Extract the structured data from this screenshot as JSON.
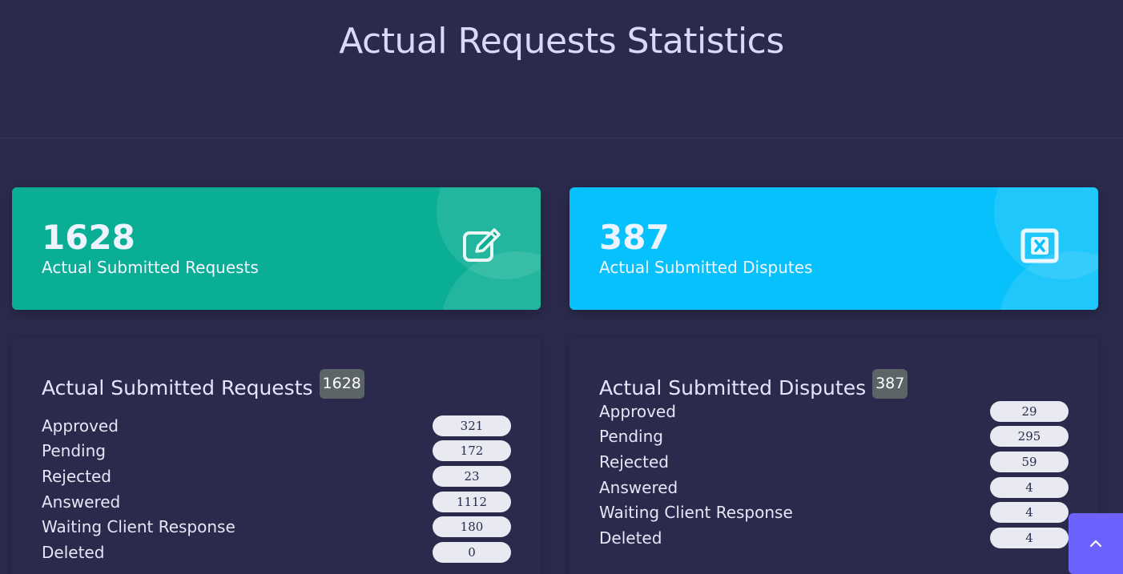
{
  "header": {
    "title": "Actual Requests Statistics"
  },
  "stat_cards": {
    "requests": {
      "value": "1628",
      "label": "Actual Submitted Requests",
      "icon": "edit-icon",
      "color": "#0aae94"
    },
    "disputes": {
      "value": "387",
      "label": "Actual Submitted Disputes",
      "icon": "close-box-icon",
      "color": "#06c1fb"
    }
  },
  "lists": {
    "requests": {
      "title": "Actual Submitted Requests",
      "total": "1628",
      "rows": [
        {
          "label": "Approved",
          "value": "321"
        },
        {
          "label": "Pending",
          "value": "172"
        },
        {
          "label": "Rejected",
          "value": "23"
        },
        {
          "label": "Answered",
          "value": "1112"
        },
        {
          "label": "Waiting Client Response",
          "value": "180"
        },
        {
          "label": "Deleted",
          "value": "0"
        }
      ]
    },
    "disputes": {
      "title": "Actual Submitted Disputes",
      "total": "387",
      "rows": [
        {
          "label": "Approved",
          "value": "29"
        },
        {
          "label": "Pending",
          "value": "295"
        },
        {
          "label": "Rejected",
          "value": "59"
        },
        {
          "label": "Answered",
          "value": "4"
        },
        {
          "label": "Waiting Client Response",
          "value": "4"
        },
        {
          "label": "Deleted",
          "value": "4"
        }
      ]
    }
  },
  "scroll_top": {
    "icon": "chevron-up-icon",
    "color": "#6c63ff"
  }
}
